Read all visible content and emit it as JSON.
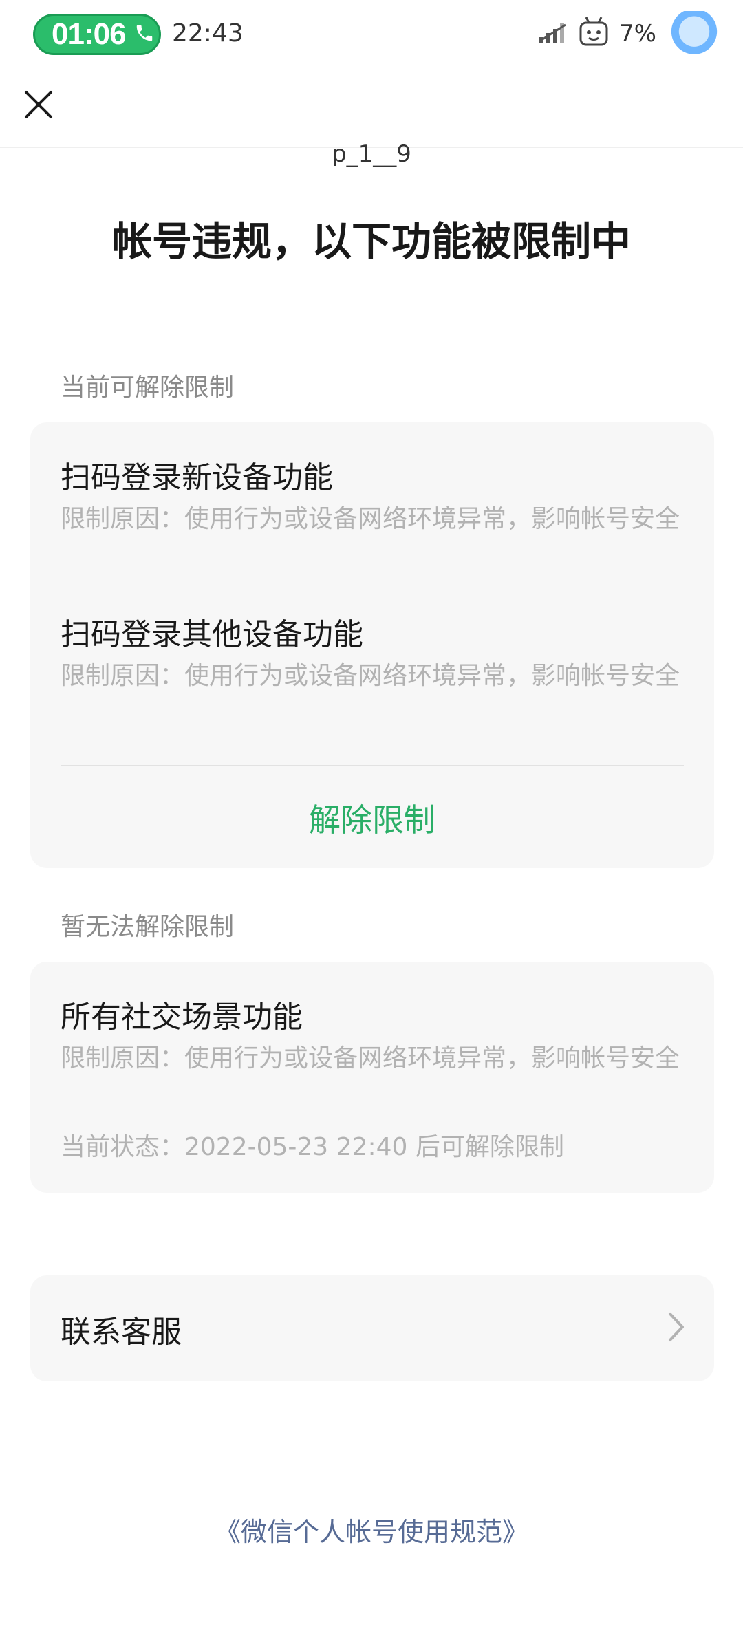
{
  "status_bar": {
    "call_timer": "01:06",
    "clock": "22:43",
    "battery": "7%"
  },
  "nav": {
    "close_icon": "close-icon"
  },
  "account_id": "p_1__9",
  "headline": "帐号违规，以下功能被限制中",
  "removable_section": {
    "label": "当前可解除限制",
    "items": [
      {
        "title": "扫码登录新设备功能",
        "reason": "限制原因：使用行为或设备网络环境异常，影响帐号安全"
      },
      {
        "title": "扫码登录其他设备功能",
        "reason": "限制原因：使用行为或设备网络环境异常，影响帐号安全"
      }
    ],
    "button_label": "解除限制"
  },
  "locked_section": {
    "label": "暂无法解除限制",
    "items": [
      {
        "title": "所有社交场景功能",
        "reason": "限制原因：使用行为或设备网络环境异常，影响帐号安全",
        "status": "当前状态：2022-05-23 22:40 后可解除限制"
      }
    ]
  },
  "contact": {
    "label": "联系客服"
  },
  "footer_link": "《微信个人帐号使用规范》",
  "colors": {
    "accent_green": "#2aae67",
    "link_blue": "#576b95",
    "card_bg": "#f7f7f7"
  }
}
